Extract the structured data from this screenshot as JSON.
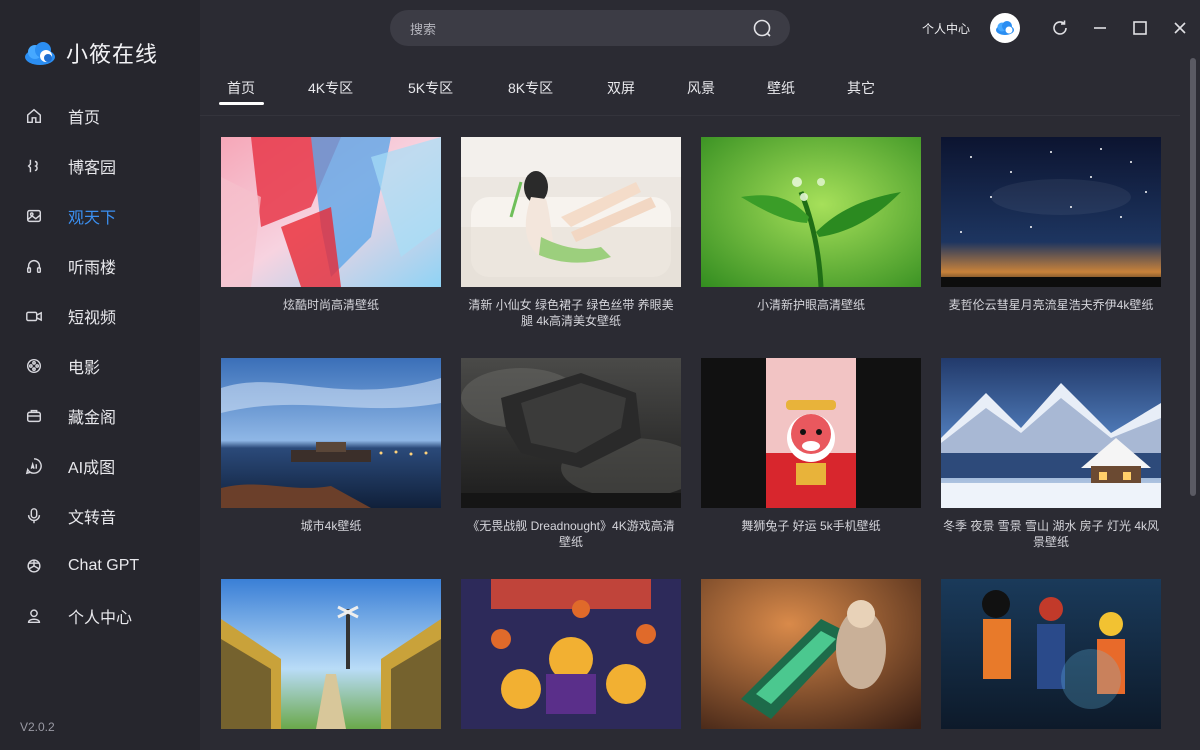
{
  "app": {
    "name": "小筱在线",
    "version": "V2.0.2"
  },
  "sidebar": {
    "items": [
      {
        "label": "首页",
        "icon": "home-icon"
      },
      {
        "label": "博客园",
        "icon": "code-bracket-icon"
      },
      {
        "label": "观天下",
        "icon": "image-icon",
        "active": true
      },
      {
        "label": "听雨楼",
        "icon": "headphones-icon"
      },
      {
        "label": "短视频",
        "icon": "video-camera-icon"
      },
      {
        "label": "电影",
        "icon": "film-reel-icon"
      },
      {
        "label": "藏金阁",
        "icon": "briefcase-icon"
      },
      {
        "label": "AI成图",
        "icon": "ai-badge-icon"
      },
      {
        "label": "文转音",
        "icon": "microphone-icon"
      },
      {
        "label": "Chat GPT",
        "icon": "openai-icon"
      },
      {
        "label": "个人中心",
        "icon": "user-icon"
      }
    ],
    "accent": "#3b8ff0"
  },
  "header": {
    "search_placeholder": "搜索",
    "user_center": "个人中心"
  },
  "tabs": [
    {
      "label": "首页",
      "active": true
    },
    {
      "label": "4K专区"
    },
    {
      "label": "5K专区"
    },
    {
      "label": "8K专区"
    },
    {
      "label": "双屏"
    },
    {
      "label": "风景"
    },
    {
      "label": "壁纸"
    },
    {
      "label": "其它"
    }
  ],
  "wallpapers": [
    {
      "title": "炫酷时尚高清壁纸"
    },
    {
      "title": "清新 小仙女 绿色裙子 绿色丝带 养眼美腿 4k高清美女壁纸"
    },
    {
      "title": "小清新护眼高清壁纸"
    },
    {
      "title": "麦哲伦云彗星月亮流星浩夫乔伊4k壁纸"
    },
    {
      "title": "城市4k壁纸"
    },
    {
      "title": "《无畏战舰 Dreadnought》4K游戏高清壁纸"
    },
    {
      "title": "舞狮兔子 好运 5k手机壁纸"
    },
    {
      "title": "冬季 夜景 雪景 雪山 湖水 房子 灯光 4k风景壁纸"
    },
    {
      "title": ""
    },
    {
      "title": ""
    },
    {
      "title": ""
    },
    {
      "title": ""
    }
  ]
}
